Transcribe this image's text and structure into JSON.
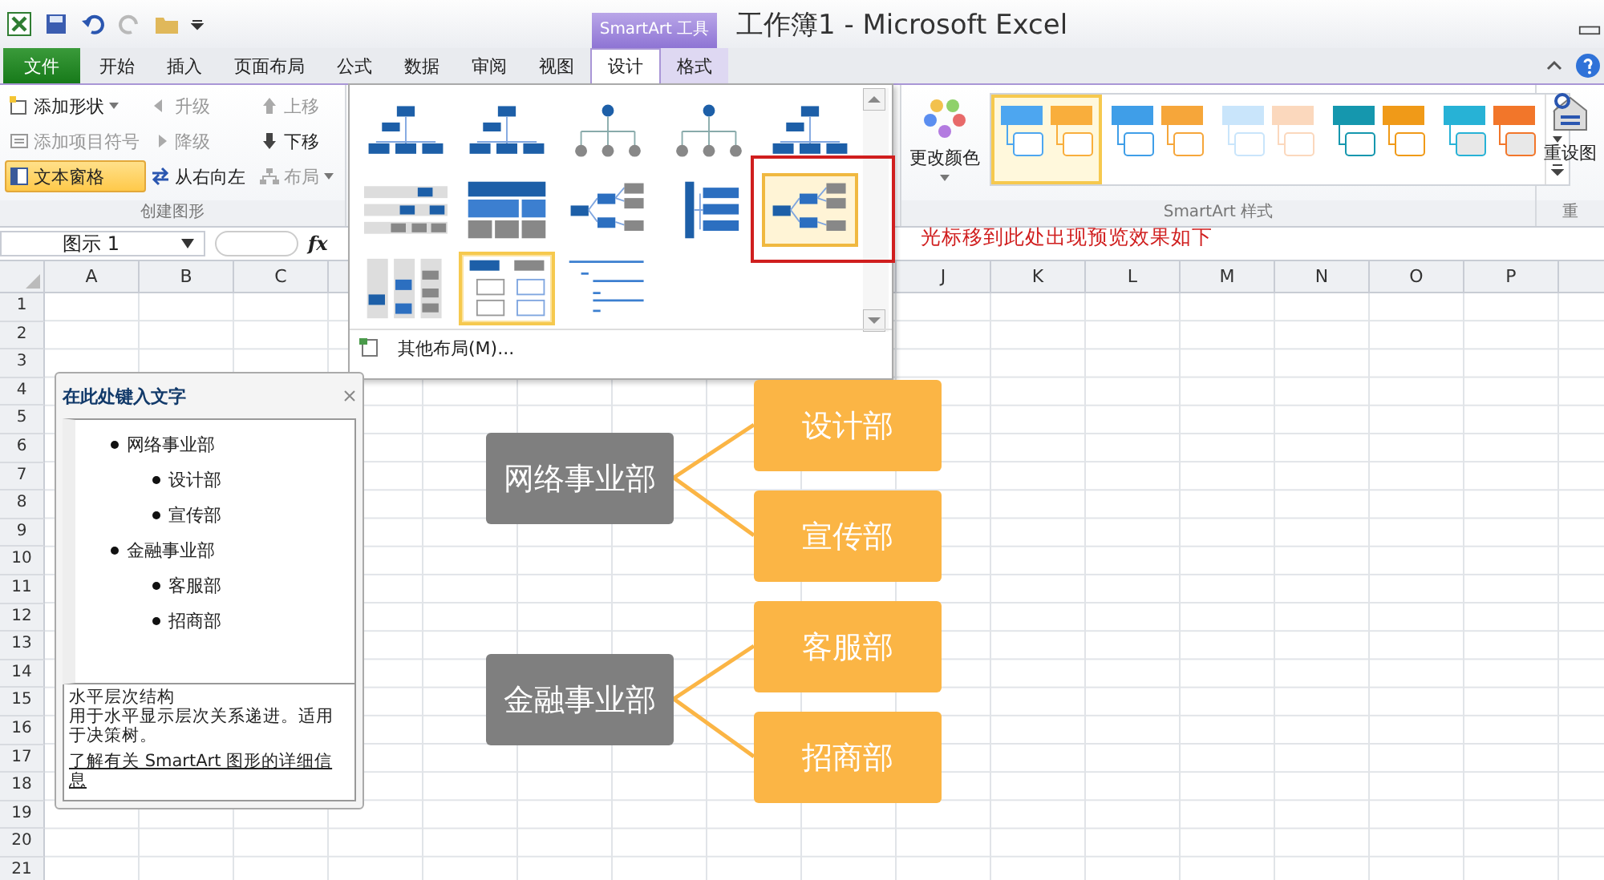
{
  "window": {
    "title": "工作簿1 - Microsoft Excel",
    "tool_group": "SmartArt 工具"
  },
  "tabs": [
    {
      "label": "文件",
      "kind": "file",
      "selected": false
    },
    {
      "label": "开始",
      "kind": "tab",
      "selected": false
    },
    {
      "label": "插入",
      "kind": "tab",
      "selected": false
    },
    {
      "label": "页面布局",
      "kind": "tab",
      "selected": false
    },
    {
      "label": "公式",
      "kind": "tab",
      "selected": false
    },
    {
      "label": "数据",
      "kind": "tab",
      "selected": false
    },
    {
      "label": "审阅",
      "kind": "tab",
      "selected": false
    },
    {
      "label": "视图",
      "kind": "tab",
      "selected": false
    },
    {
      "label": "设计",
      "kind": "tool",
      "selected": true
    },
    {
      "label": "格式",
      "kind": "tool",
      "selected": false
    }
  ],
  "create_group": {
    "title": "创建图形",
    "columns": [
      [
        {
          "label": "添加形状",
          "dropdown": true,
          "disabled": false,
          "selected": false
        },
        {
          "label": "添加项目符号",
          "dropdown": false,
          "disabled": true,
          "selected": false
        },
        {
          "label": "文本窗格",
          "dropdown": false,
          "disabled": false,
          "selected": true
        }
      ],
      [
        {
          "label": "升级",
          "dropdown": false,
          "disabled": true,
          "selected": false
        },
        {
          "label": "降级",
          "dropdown": false,
          "disabled": true,
          "selected": false
        },
        {
          "label": "从右向左",
          "dropdown": false,
          "disabled": false,
          "selected": false
        }
      ],
      [
        {
          "label": "上移",
          "dropdown": false,
          "disabled": true,
          "selected": false
        },
        {
          "label": "下移",
          "dropdown": false,
          "disabled": false,
          "selected": false
        },
        {
          "label": "布局",
          "dropdown": true,
          "disabled": true,
          "selected": false
        }
      ]
    ]
  },
  "change_colors": "更改颜色",
  "styles_group": {
    "title": "SmartArt 样式",
    "styles": [
      {
        "selected": true,
        "shapes": [
          {
            "color": "#4da6f0"
          },
          {
            "color": "#f9ae3c"
          }
        ]
      },
      {
        "selected": false,
        "shapes": [
          {
            "color": "#3f9ee8"
          },
          {
            "color": "#f6a63a"
          }
        ]
      },
      {
        "selected": false,
        "shapes": [
          {
            "color": "#c9e5fb"
          },
          {
            "color": "#fbd8bd"
          }
        ]
      },
      {
        "selected": false,
        "shapes": [
          {
            "color": "#1597ae"
          },
          {
            "color": "#f09a18"
          }
        ]
      },
      {
        "selected": false,
        "shapes": [
          {
            "color": "#27b2d6"
          },
          {
            "color": "#f2762a"
          }
        ]
      }
    ]
  },
  "reset": {
    "label": "重设图",
    "group_title": "重"
  },
  "name_box": "图示 1",
  "function_label": "fx",
  "layout_gallery": {
    "layouts": [
      {
        "kind": "org",
        "selected": false,
        "hovered": false
      },
      {
        "kind": "org",
        "selected": false,
        "hovered": false
      },
      {
        "kind": "circle",
        "selected": false,
        "hovered": false
      },
      {
        "kind": "circle",
        "selected": false,
        "hovered": false
      },
      {
        "kind": "org",
        "selected": false,
        "hovered": false
      },
      {
        "kind": "table",
        "selected": false,
        "hovered": false
      },
      {
        "kind": "blocks",
        "selected": false,
        "hovered": false
      },
      {
        "kind": "horizontal",
        "selected": false,
        "hovered": false
      },
      {
        "kind": "label",
        "selected": false,
        "hovered": false
      },
      {
        "kind": "horizontal",
        "selected": false,
        "hovered": true
      },
      {
        "kind": "columns",
        "selected": false,
        "hovered": false
      },
      {
        "kind": "list",
        "selected": true,
        "hovered": false
      },
      {
        "kind": "lines",
        "selected": false,
        "hovered": false
      }
    ],
    "more_layouts": "其他布局(M)..."
  },
  "annotation": "光标移到此处出现预览效果如下",
  "columns_left": [
    "A",
    "B",
    "C"
  ],
  "columns_right": [
    "J",
    "K",
    "L",
    "M",
    "N",
    "O",
    "P"
  ],
  "rows": [
    "1",
    "2",
    "3",
    "4",
    "5",
    "6",
    "7",
    "8",
    "9",
    "10",
    "11",
    "12",
    "13",
    "14",
    "15",
    "16",
    "17",
    "18",
    "19",
    "20",
    "21"
  ],
  "text_pane": {
    "title": "在此处键入文字",
    "items": [
      {
        "text": "网络事业部",
        "children": [
          {
            "text": "设计部"
          },
          {
            "text": "宣传部"
          }
        ]
      },
      {
        "text": "金融事业部",
        "children": [
          {
            "text": "客服部"
          },
          {
            "text": "招商部"
          }
        ]
      }
    ],
    "layout_name": "水平层次结构",
    "description": "用于水平显示层次关系递进。适用于决策树。",
    "link": "了解有关 SmartArt 图形的详细信息"
  },
  "diagram": {
    "nodes": [
      {
        "text": "网络事业部",
        "children": [
          {
            "text": "设计部"
          },
          {
            "text": "宣传部"
          }
        ]
      },
      {
        "text": "金融事业部",
        "children": [
          {
            "text": "客服部"
          },
          {
            "text": "招商部"
          }
        ]
      }
    ]
  }
}
